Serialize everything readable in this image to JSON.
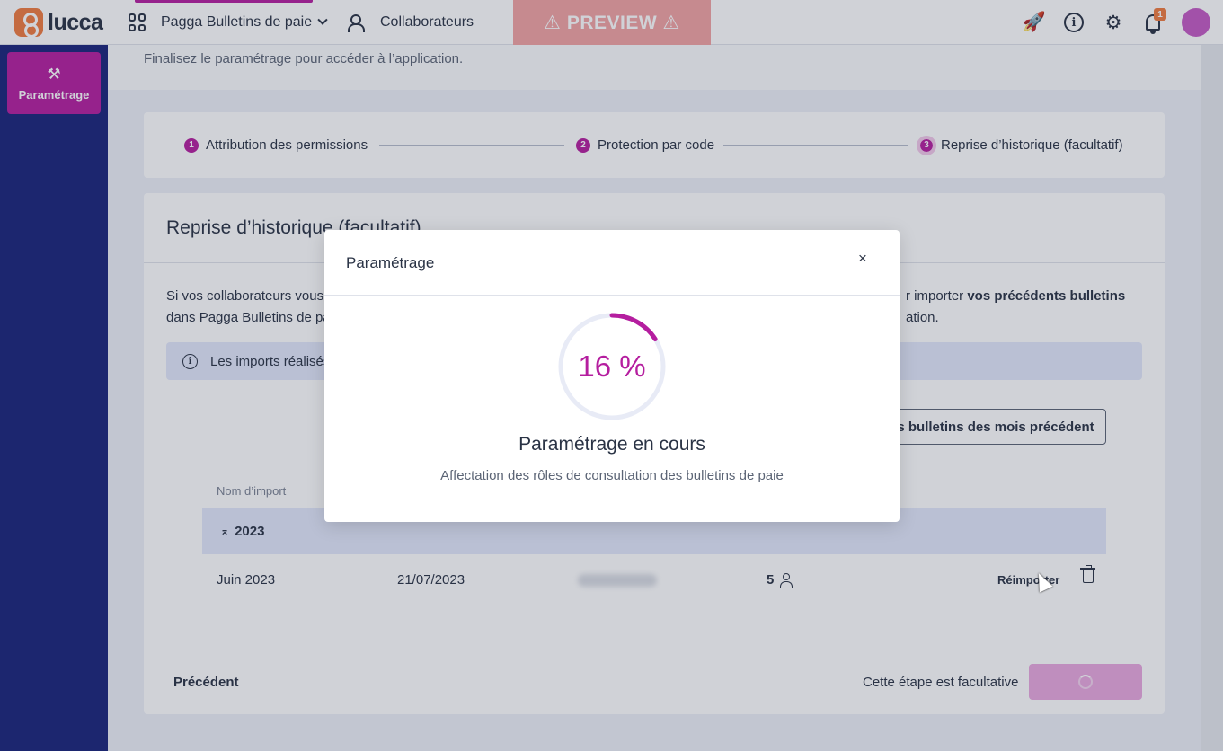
{
  "topbar": {
    "logo_text": "lucca",
    "app_name": "Pagga Bulletins de paie",
    "collaborateurs": "Collaborateurs",
    "preview": "⚠ PREVIEW ⚠",
    "notification_count": "1",
    "accent_color": "#b51e9f"
  },
  "sidenav": {
    "item_label": "Paramétrage"
  },
  "page": {
    "intro": "Finalisez le paramétrage pour accéder à l’application."
  },
  "stepper": {
    "steps": [
      {
        "num": "1",
        "label": "Attribution des permissions"
      },
      {
        "num": "2",
        "label": "Protection par code"
      },
      {
        "num": "3",
        "label": "Reprise d’historique (facultatif)"
      }
    ]
  },
  "card": {
    "title": "Reprise d’historique (facultatif)",
    "text_left_1": "Si vos collaborateurs vous",
    "text_left_2": "dans Pagga Bulletins de pa",
    "text_right_1_pre": "r importer ",
    "text_right_1_bold": "vos précédents bulletins",
    "text_right_2": "ation.",
    "info_text": "Les imports réalisés",
    "outline_button": "s bulletins des mois précédent",
    "table_header": "Nom d’import",
    "group_year": "2023",
    "row": {
      "name": "Juin 2023",
      "date": "21/07/2023",
      "count": "5",
      "reimport": "Réimporter"
    },
    "previous": "Précédent",
    "optional_note": "Cette étape est facultative"
  },
  "modal": {
    "title": "Paramétrage",
    "close": "×",
    "progress_percent": 16,
    "progress_label": "16 %",
    "heading": "Paramétrage en cours",
    "subtext": "Affectation des rôles de consultation des bulletins de paie"
  }
}
